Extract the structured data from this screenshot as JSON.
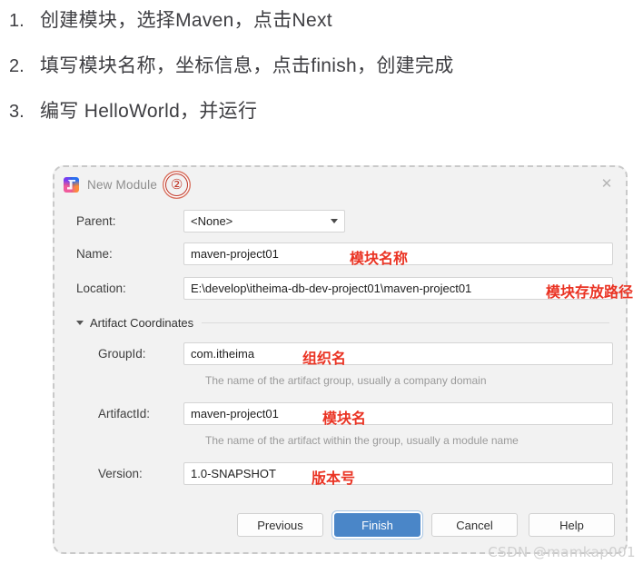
{
  "instructions": [
    {
      "num": "1.",
      "text": "创建模块，选择Maven，点击Next"
    },
    {
      "num": "2.",
      "text": "填写模块名称，坐标信息，点击finish，创建完成"
    },
    {
      "num": "3.",
      "text": "编写 HelloWorld，并运行"
    }
  ],
  "dialog": {
    "title": "New Module",
    "app_icon": "intellij-idea-icon",
    "step_annotation": "②",
    "close_icon": "close-icon",
    "fields": {
      "parent": {
        "label": "Parent:",
        "value": "<None>",
        "type": "dropdown"
      },
      "name": {
        "label": "Name:",
        "value": "maven-project01",
        "annotation": "模块名称"
      },
      "location": {
        "label": "Location:",
        "value": "E:\\develop\\itheima-db-dev-project01\\maven-project01",
        "annotation": "模块存放路径"
      }
    },
    "artifact_section": {
      "title": "Artifact Coordinates",
      "expanded": true,
      "group_id": {
        "label": "GroupId:",
        "value": "com.itheima",
        "annotation": "组织名",
        "hint": "The name of the artifact group, usually a company domain"
      },
      "artifact_id": {
        "label": "ArtifactId:",
        "value": "maven-project01",
        "annotation": "模块名",
        "hint": "The name of the artifact within the group, usually a module name"
      },
      "version": {
        "label": "Version:",
        "value": "1.0-SNAPSHOT",
        "annotation": "版本号"
      }
    },
    "buttons": {
      "previous": "Previous",
      "finish": "Finish",
      "cancel": "Cancel",
      "help": "Help"
    }
  },
  "watermark": "CSDN @mamkap001",
  "colors": {
    "primary_button": "#4a86c8",
    "annotation_red": "#ea3323",
    "step_circle_red": "#c0392b",
    "dialog_background": "#f2f2f2"
  }
}
